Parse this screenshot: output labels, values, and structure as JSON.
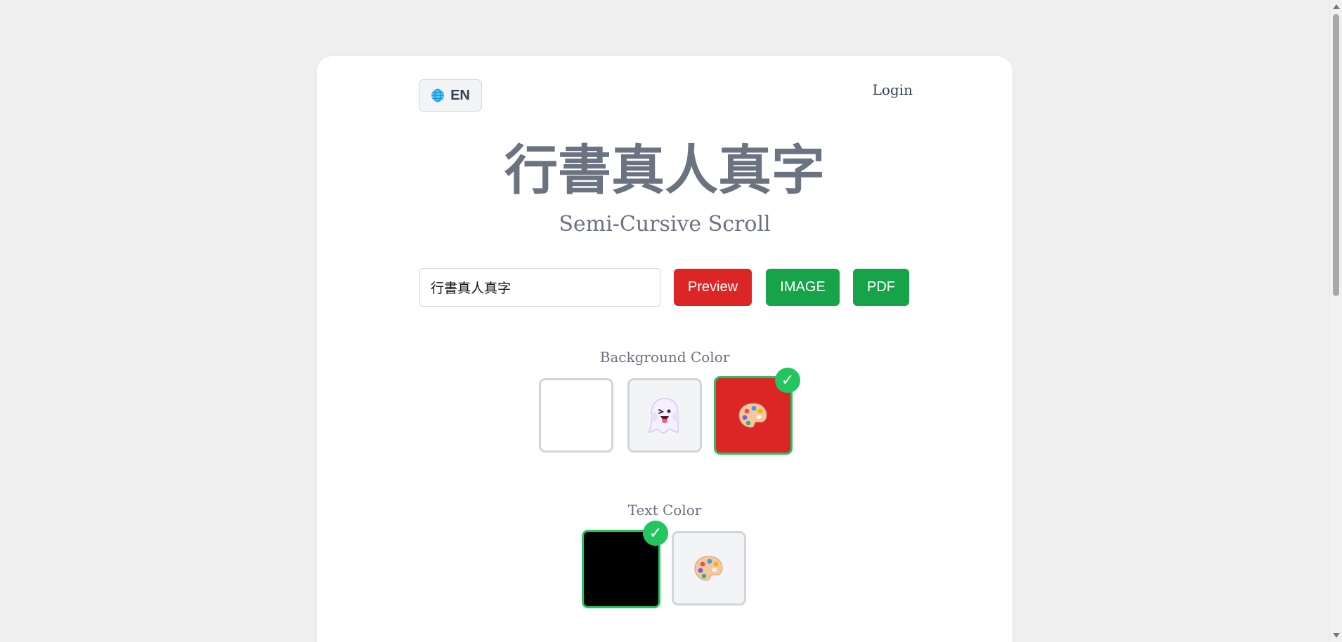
{
  "header": {
    "language_label": "EN",
    "language_icon": "globe-icon",
    "login_label": "Login"
  },
  "hero": {
    "title": "行書真人真字",
    "subtitle": "Semi-Cursive Scroll"
  },
  "controls": {
    "text_value": "行書真人真字",
    "preview_label": "Preview",
    "image_label": "IMAGE",
    "pdf_label": "PDF"
  },
  "background_color": {
    "label": "Background Color",
    "options": [
      {
        "name": "white",
        "icon": "",
        "color": "#ffffff",
        "selected": false
      },
      {
        "name": "ghost",
        "icon": "ghost-icon",
        "color": "#f3f4f6",
        "selected": false
      },
      {
        "name": "custom",
        "icon": "palette-icon",
        "color": "#dc2626",
        "selected": true
      }
    ]
  },
  "text_color": {
    "label": "Text Color",
    "options": [
      {
        "name": "black",
        "icon": "",
        "color": "#000000",
        "selected": true
      },
      {
        "name": "custom",
        "icon": "palette-icon",
        "color": "#f3f4f6",
        "selected": false
      }
    ]
  },
  "colors": {
    "accent_red": "#dc2626",
    "accent_green": "#16a34a",
    "check_green": "#22c55e"
  }
}
